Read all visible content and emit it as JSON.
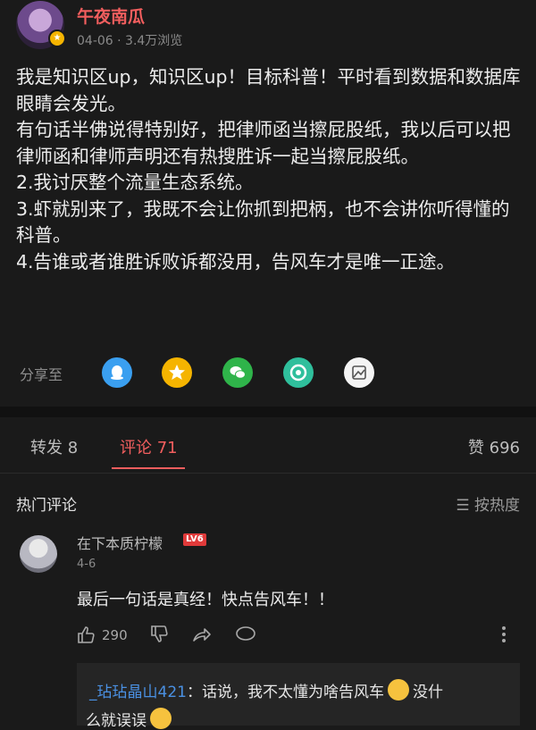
{
  "post": {
    "author": "午夜南瓜",
    "date": "04-06",
    "views": "3.4万浏览",
    "content": [
      "我是知识区up，知识区up！目标科普！平时看到数据和数据库眼睛会发光。",
      "有句话半佛说得特别好，把律师函当擦屁股纸，我以后可以把律师函和律师声明还有热搜胜诉一起当擦屁股纸。",
      "2.我讨厌整个流量生态系统。",
      "3.虾就别来了，我既不会让你抓到把柄，也不会讲你听得懂的科普。",
      "4.告谁或者谁胜诉败诉都没用，告风车才是唯一正途。"
    ],
    "share_label": "分享至",
    "share_icons": [
      "qq-icon",
      "qzone-icon",
      "wechat-icon",
      "moments-icon",
      "album-icon"
    ]
  },
  "tabs": {
    "repost": "转发 8",
    "comments": "评论 71",
    "likes": "赞 696"
  },
  "comments_section": {
    "title": "热门评论",
    "sort_label": "按热度"
  },
  "comment": {
    "username": "在下本质柠檬",
    "level": "LV6",
    "date": "4-6",
    "text": "最后一句话是真经！快点告风车！！",
    "like_count": "290",
    "reply": {
      "user": "_玷玷晶山421",
      "text_a": "：话说，我不太懂为啥告风车",
      "text_b": "没什",
      "text_c": "么就误误"
    }
  },
  "colors": {
    "accent": "#f25e5e",
    "link": "#4a90e2",
    "background": "#1a1a1a"
  }
}
